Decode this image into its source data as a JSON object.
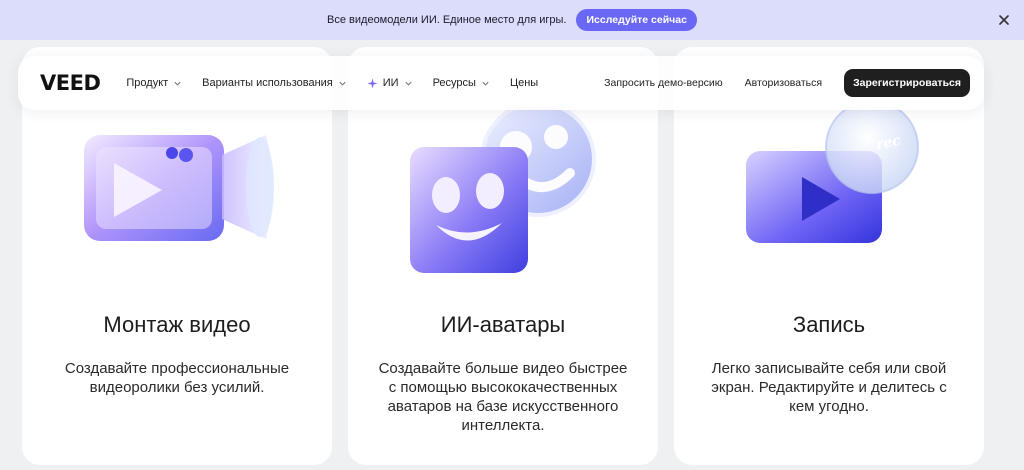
{
  "banner": {
    "text": "Все видеомодели ИИ. Единое место для игры.",
    "cta_label": "Исследуйте сейчас",
    "close_icon": "close-icon"
  },
  "navbar": {
    "logo": "VEED",
    "menu": [
      {
        "label": "Продукт",
        "has_dropdown": true
      },
      {
        "label": "Варианты использования",
        "has_dropdown": true
      },
      {
        "label": "ИИ",
        "has_dropdown": true,
        "icon": "sparkle-icon"
      },
      {
        "label": "Ресурсы",
        "has_dropdown": true
      },
      {
        "label": "Цены",
        "has_dropdown": false
      }
    ],
    "demo_label": "Запросить демо-версию",
    "login_label": "Авторизоваться",
    "signup_label": "Зарегистрироваться"
  },
  "cards": [
    {
      "title": "Монтаж видео",
      "description": "Создавайте профессиональные видеоролики без усилий.",
      "icon": "video-camera-icon"
    },
    {
      "title": "ИИ-аватары",
      "description": "Создавайте больше видео быстрее с помощью высококачественных аватаров на базе искусственного интеллекта.",
      "icon": "avatar-face-icon"
    },
    {
      "title": "Запись",
      "description": "Легко записывайте себя или свой экран. Редактируйте и делитесь с кем угодно.",
      "icon": "record-icon",
      "badge": "rec"
    }
  ],
  "colors": {
    "banner_bg": "#dcdcfb",
    "accent": "#6a67f4",
    "dark_button": "#1f1f1f",
    "page_bg": "#eef0f1"
  }
}
